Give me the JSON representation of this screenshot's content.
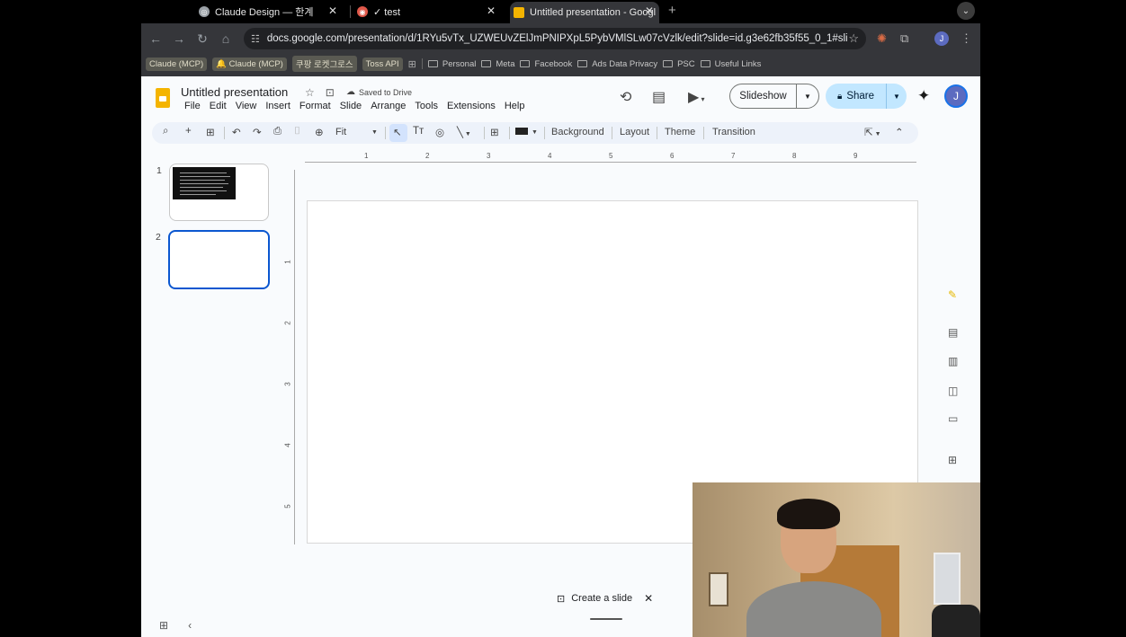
{
  "browser": {
    "tabs": [
      {
        "title": "Claude Design — 한계",
        "favicon_color": "#9aa0a6"
      },
      {
        "title": "✓ test",
        "favicon_color": "#e0584a"
      },
      {
        "title": "Untitled presentation - Googl",
        "favicon_color": "#f4b400"
      }
    ],
    "url": "docs.google.com/presentation/d/1RYu5vTx_UZWEUvZElJmPNIPXpL5PybVMlSLw07cVzlk/edit?slide=id.g3e62fb35f55_0_1#slide=i...",
    "bookmarks": [
      {
        "label": "Claude (MCP)",
        "type": "chip"
      },
      {
        "label": "🔔 Claude (MCP)",
        "type": "chip"
      },
      {
        "label": "쿠팡 로켓그로스",
        "type": "chip"
      },
      {
        "label": "Toss API",
        "type": "chip"
      },
      {
        "label": "Personal",
        "type": "folder"
      },
      {
        "label": "Meta",
        "type": "folder"
      },
      {
        "label": "Facebook",
        "type": "folder"
      },
      {
        "label": "Ads Data Privacy",
        "type": "folder"
      },
      {
        "label": "PSC",
        "type": "folder"
      },
      {
        "label": "Useful Links",
        "type": "folder"
      }
    ]
  },
  "slides": {
    "title": "Untitled presentation",
    "saved_status": "Saved to Drive",
    "menu": [
      "File",
      "Edit",
      "View",
      "Insert",
      "Format",
      "Slide",
      "Arrange",
      "Tools",
      "Extensions",
      "Help"
    ],
    "slideshow_label": "Slideshow",
    "share_label": "Share",
    "avatar_initial": "J",
    "zoom_label": "Fit",
    "toolbar_text": {
      "background": "Background",
      "layout": "Layout",
      "theme": "Theme",
      "transition": "Transition"
    },
    "thumbnails": [
      {
        "number": "1"
      },
      {
        "number": "2"
      }
    ],
    "ruler_h": [
      "1",
      "2",
      "3",
      "4",
      "5",
      "6",
      "7",
      "8",
      "9"
    ],
    "ruler_v": [
      "1",
      "2",
      "3",
      "4",
      "5"
    ],
    "create_slide_label": "Create a slide"
  },
  "colors": {
    "accent": "#0b57d0",
    "share_bg": "#c2e7ff",
    "logo": "#f4b400"
  }
}
